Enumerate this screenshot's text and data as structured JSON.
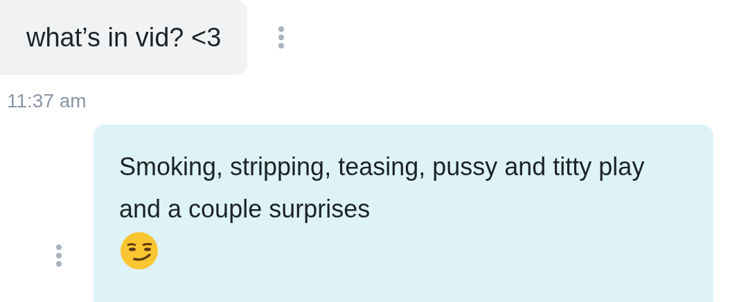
{
  "messages": [
    {
      "kind": "received",
      "text": "what’s in vid? <3"
    },
    {
      "kind": "time",
      "text": "11:37 am"
    },
    {
      "kind": "sent",
      "text": "Smoking, stripping, teasing, pussy and titty play and a couple surprises",
      "has_emoji": true
    }
  ]
}
